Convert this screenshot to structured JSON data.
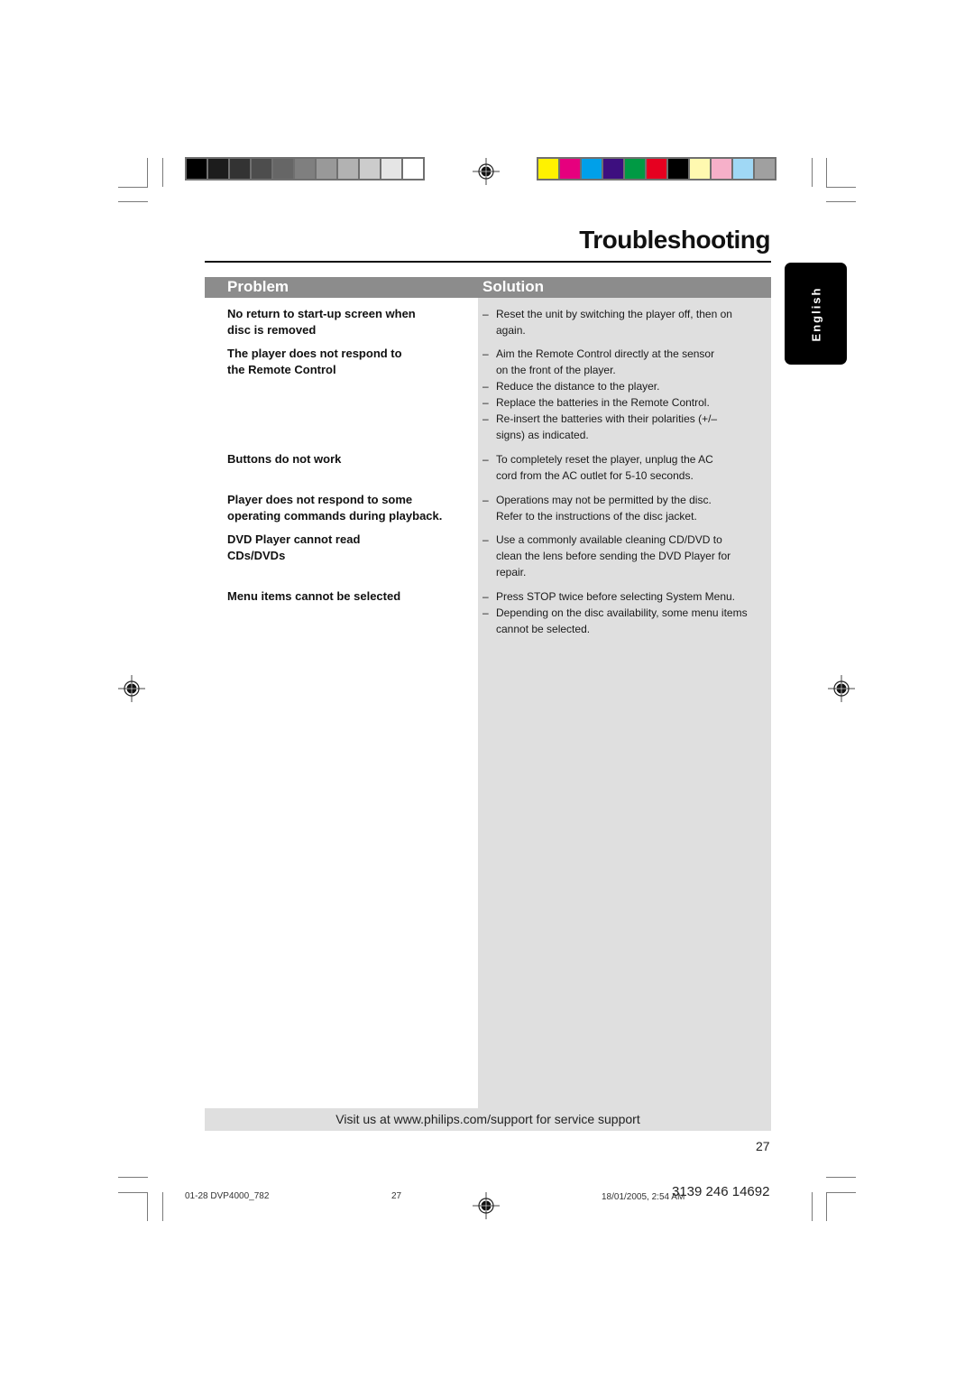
{
  "page": {
    "title": "Troubleshooting",
    "language_tab": "English",
    "page_number": "27"
  },
  "table": {
    "headers": {
      "problem": "Problem",
      "solution": "Solution"
    },
    "rows": [
      {
        "problem": [
          "No return to start-up screen when",
          "disc is removed"
        ],
        "solutions": [
          [
            "Reset the unit by switching the player off, then on",
            "again."
          ]
        ]
      },
      {
        "problem": [
          "The player does not respond to",
          "the Remote Control"
        ],
        "solutions": [
          [
            "Aim the Remote Control directly at the sensor",
            "on the front of the player."
          ],
          [
            "Reduce the distance to the player."
          ],
          [
            "Replace the batteries in the Remote Control."
          ],
          [
            "Re-insert the batteries with their polarities (+/–",
            "signs) as indicated."
          ]
        ]
      },
      {
        "problem": [
          "Buttons do not work"
        ],
        "solutions": [
          [
            "To completely reset the player, unplug the AC",
            "cord from the AC outlet for 5-10 seconds."
          ]
        ]
      },
      {
        "problem": [
          "Player does not respond to some",
          "operating commands during playback."
        ],
        "solutions": [
          [
            "Operations may not be permitted by the disc.",
            "Refer to the instructions of  the disc jacket."
          ]
        ]
      },
      {
        "problem": [
          "DVD Player cannot read",
          "CDs/DVDs"
        ],
        "solutions": [
          [
            "Use a commonly available cleaning CD/DVD to",
            "clean the lens before sending the DVD Player for",
            "repair."
          ]
        ]
      },
      {
        "problem": [
          "Menu items cannot be selected"
        ],
        "solutions": [
          [
            "Press STOP twice before selecting System Menu."
          ],
          [
            "Depending on the disc availability, some menu items",
            "cannot be selected."
          ]
        ]
      }
    ],
    "dash": "–"
  },
  "footer": {
    "support_text": "Visit us at www.philips.com/support for service support"
  },
  "print_slug": {
    "file": "01-28 DVP4000_782",
    "page": "27",
    "timestamp": "18/01/2005, 2:54 AM",
    "doc_code": "3139 246 14692"
  },
  "calibration": {
    "grey_swatches": [
      "#000000",
      "#1c1c1c",
      "#333333",
      "#4d4d4d",
      "#666666",
      "#7f7f7f",
      "#999999",
      "#b2b2b2",
      "#cccccc",
      "#e5e5e5",
      "#ffffff"
    ],
    "color_swatches": [
      "#fff200",
      "#e6007e",
      "#00a0e9",
      "#3d0f7f",
      "#009a44",
      "#e60020",
      "#000000",
      "#fff9b0",
      "#f6b0c9",
      "#a0d8f5",
      "#a0a0a0"
    ]
  }
}
